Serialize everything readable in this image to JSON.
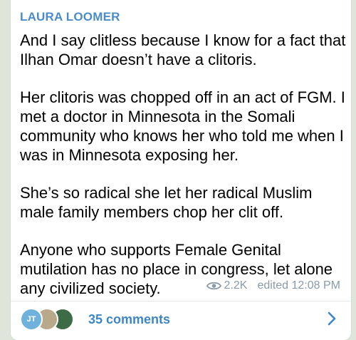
{
  "post": {
    "author": "LAURA LOOMER",
    "paragraphs": [
      "And I say clitless because I know for a fact that Ilhan Omar doesn’t have a clitoris.",
      "Her clitoris was chopped off in an act of FGM. I met a doctor in Minnesota in the Somali community who knows her who told me when I was in Minnesota exposing her.",
      "She’s so radical she let her radical Muslim male family members chop her clit off.",
      "Anyone who supports Female Genital mutilation has no place in congress, let alone any civilized society."
    ],
    "views": "2.2K",
    "timestamp": "edited 12:08 PM"
  },
  "footer": {
    "avatar_initials": "JT",
    "comments_label": "35 comments"
  },
  "icons": {
    "views": "eye-icon",
    "open_comments": "chevron-right-icon"
  },
  "colors": {
    "author": "#4c8bca",
    "link": "#3d86c6",
    "meta": "#8a9aa7",
    "background": "#dfe6d9"
  }
}
